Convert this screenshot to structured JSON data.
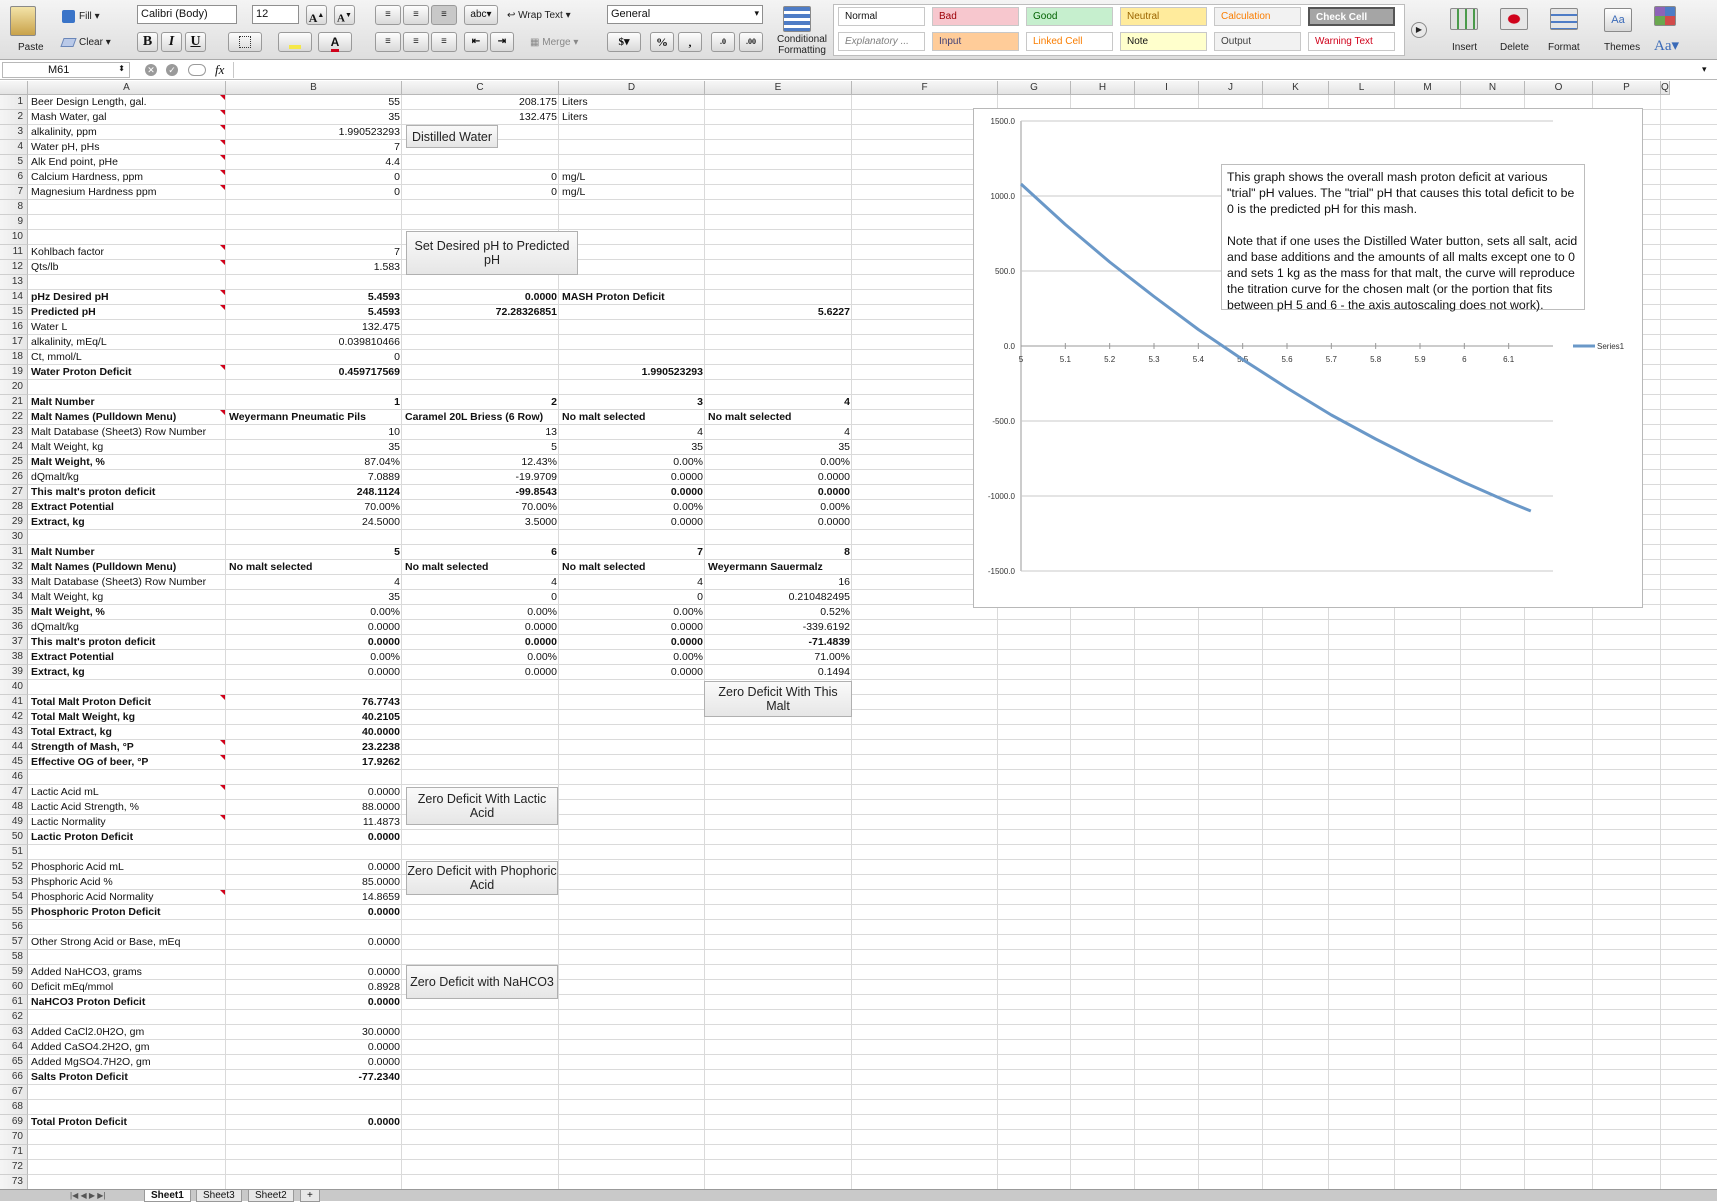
{
  "ribbon": {
    "paste": "Paste",
    "fill": "Fill",
    "clear": "Clear",
    "font_name": "Calibri (Body)",
    "font_size": "12",
    "wrap_text": "Wrap Text",
    "merge": "Merge",
    "number_format": "General",
    "conditional_formatting": "Conditional Formatting",
    "styles": [
      {
        "label": "Normal",
        "bg": "#ffffff",
        "fg": "#111111"
      },
      {
        "label": "Bad",
        "bg": "#f7c7ce",
        "fg": "#9c0006"
      },
      {
        "label": "Good",
        "bg": "#c6efce",
        "fg": "#006100"
      },
      {
        "label": "Neutral",
        "bg": "#ffeb9c",
        "fg": "#9c6500"
      },
      {
        "label": "Calculation",
        "bg": "#f2f2f2",
        "fg": "#fa7d00"
      },
      {
        "label": "Check Cell",
        "bg": "#a5a5a5",
        "fg": "#ffffff"
      },
      {
        "label": "Explanatory ...",
        "bg": "#ffffff",
        "fg": "#7f7f7f"
      },
      {
        "label": "Input",
        "bg": "#ffcc99",
        "fg": "#3f3f76"
      },
      {
        "label": "Linked Cell",
        "bg": "#ffffff",
        "fg": "#fa7d00"
      },
      {
        "label": "Note",
        "bg": "#ffffcc",
        "fg": "#111111"
      },
      {
        "label": "Output",
        "bg": "#f2f2f2",
        "fg": "#3f3f3f"
      },
      {
        "label": "Warning Text",
        "bg": "#ffffff",
        "fg": "#d0021b"
      }
    ],
    "insert": "Insert",
    "delete": "Delete",
    "format": "Format",
    "themes": "Themes",
    "aa": "Aa"
  },
  "formula_bar": {
    "name_box": "M61",
    "fx": "fx",
    "value": ""
  },
  "columns": [
    "A",
    "B",
    "C",
    "D",
    "E",
    "F",
    "G",
    "H",
    "I",
    "J",
    "K",
    "L",
    "M",
    "N",
    "O",
    "P",
    "Q"
  ],
  "rows": [
    {
      "n": 1,
      "A": "Beer Design Length, gal.",
      "B": "55",
      "C": "208.175",
      "D": "Liters"
    },
    {
      "n": 2,
      "A": "Mash Water, gal",
      "B": "35",
      "C": "132.475",
      "D": "Liters"
    },
    {
      "n": 3,
      "A": "alkalinity, ppm",
      "B": "1.990523293"
    },
    {
      "n": 4,
      "A": "Water pH, pHs",
      "B": "7"
    },
    {
      "n": 5,
      "A": "Alk End point, pHe",
      "B": "4.4"
    },
    {
      "n": 6,
      "A": "Calcium Hardness, ppm",
      "B": "0",
      "C": "0",
      "D": "mg/L"
    },
    {
      "n": 7,
      "A": "Magnesium Hardness ppm",
      "B": "0",
      "C": "0",
      "D": "mg/L"
    },
    {
      "n": 8
    },
    {
      "n": 9
    },
    {
      "n": 10
    },
    {
      "n": 11,
      "A": "Kohlbach factor",
      "B": "7"
    },
    {
      "n": 12,
      "A": "Qts/lb",
      "B": "1.583"
    },
    {
      "n": 13
    },
    {
      "n": 14,
      "A": "pHz Desired pH",
      "B": "5.4593",
      "C": "0.0000",
      "D": "MASH Proton Deficit",
      "bold": true
    },
    {
      "n": 15,
      "A": "Predicted pH",
      "B": "5.4593",
      "C": "72.28326851",
      "E": "5.6227",
      "bold": true
    },
    {
      "n": 16,
      "A": "Water L",
      "B": "132.475"
    },
    {
      "n": 17,
      "A": "alkalinity,  mEq/L",
      "B": "0.039810466"
    },
    {
      "n": 18,
      "A": "Ct, mmol/L",
      "B": "0"
    },
    {
      "n": 19,
      "A": "Water Proton Deficit",
      "B": "0.459717569",
      "D": "1.990523293",
      "bold": true
    },
    {
      "n": 20
    },
    {
      "n": 21,
      "A": "Malt Number",
      "B": "1",
      "C": "2",
      "D": "3",
      "E": "4",
      "bold": true
    },
    {
      "n": 22,
      "A": "Malt Names (Pulldown Menu)",
      "B": "Weyermann Pneumatic Pils",
      "C": "Caramel 20L Briess (6 Row)",
      "D": "No malt selected",
      "E": "No malt selected",
      "bold": true,
      "leftText": true
    },
    {
      "n": 23,
      "A": "Malt Database (Sheet3) Row Number",
      "B": "10",
      "C": "13",
      "D": "4",
      "E": "4"
    },
    {
      "n": 24,
      "A": "Malt  Weight, kg",
      "B": "35",
      "C": "5",
      "D": "35",
      "E": "35"
    },
    {
      "n": 25,
      "A": "Malt Weight, %",
      "B": "87.04%",
      "C": "12.43%",
      "D": "0.00%",
      "E": "0.00%",
      "boldA": true
    },
    {
      "n": 26,
      "A": "dQmalt/kg",
      "B": "7.0889",
      "C": "-19.9709",
      "D": "0.0000",
      "E": "0.0000"
    },
    {
      "n": 27,
      "A": "This malt's proton deficit",
      "B": "248.1124",
      "C": "-99.8543",
      "D": "0.0000",
      "E": "0.0000",
      "bold": true
    },
    {
      "n": 28,
      "A": "Extract Potential",
      "B": "70.00%",
      "C": "70.00%",
      "D": "0.00%",
      "E": "0.00%",
      "boldA": true
    },
    {
      "n": 29,
      "A": "Extract, kg",
      "B": "24.5000",
      "C": "3.5000",
      "D": "0.0000",
      "E": "0.0000",
      "boldA": true
    },
    {
      "n": 30
    },
    {
      "n": 31,
      "A": "Malt Number",
      "B": "5",
      "C": "6",
      "D": "7",
      "E": "8",
      "bold": true
    },
    {
      "n": 32,
      "A": "Malt Names (Pulldown Menu)",
      "B": "No malt selected",
      "C": "No malt selected",
      "D": "No malt selected",
      "E": "Weyermann Sauermalz",
      "bold": true,
      "leftText": true
    },
    {
      "n": 33,
      "A": "Malt Database (Sheet3) Row Number",
      "B": "4",
      "C": "4",
      "D": "4",
      "E": "16"
    },
    {
      "n": 34,
      "A": "Malt  Weight, kg",
      "B": "35",
      "C": "0",
      "D": "0",
      "E": "0.210482495"
    },
    {
      "n": 35,
      "A": "Malt Weight, %",
      "B": "0.00%",
      "C": "0.00%",
      "D": "0.00%",
      "E": "0.52%",
      "boldA": true
    },
    {
      "n": 36,
      "A": "dQmalt/kg",
      "B": "0.0000",
      "C": "0.0000",
      "D": "0.0000",
      "E": "-339.6192"
    },
    {
      "n": 37,
      "A": "This malt's proton deficit",
      "B": "0.0000",
      "C": "0.0000",
      "D": "0.0000",
      "E": "-71.4839",
      "bold": true
    },
    {
      "n": 38,
      "A": "Extract Potential",
      "B": "0.00%",
      "C": "0.00%",
      "D": "0.00%",
      "E": "71.00%",
      "boldA": true
    },
    {
      "n": 39,
      "A": "Extract, kg",
      "B": "0.0000",
      "C": "0.0000",
      "D": "0.0000",
      "E": "0.1494",
      "boldA": true
    },
    {
      "n": 40
    },
    {
      "n": 41,
      "A": "Total Malt Proton Deficit",
      "B": "76.7743",
      "bold": true
    },
    {
      "n": 42,
      "A": "Total Malt Weight, kg",
      "B": "40.2105",
      "bold": true
    },
    {
      "n": 43,
      "A": "Total Extract, kg",
      "B": "40.0000",
      "bold": true
    },
    {
      "n": 44,
      "A": "Strength of Mash, °P",
      "B": "23.2238",
      "bold": true
    },
    {
      "n": 45,
      "A": "Effective OG of beer, °P",
      "B": "17.9262",
      "bold": true
    },
    {
      "n": 46
    },
    {
      "n": 47,
      "A": "Lactic Acid mL",
      "B": "0.0000"
    },
    {
      "n": 48,
      "A": "Lactic Acid Strength, %",
      "B": "88.0000"
    },
    {
      "n": 49,
      "A": "Lactic Normality",
      "B": "11.4873"
    },
    {
      "n": 50,
      "A": "Lactic Proton Deficit",
      "B": "0.0000",
      "bold": true
    },
    {
      "n": 51
    },
    {
      "n": 52,
      "A": "Phosphoric Acid mL",
      "B": "0.0000"
    },
    {
      "n": 53,
      "A": "Phsphoric Acid %",
      "B": "85.0000"
    },
    {
      "n": 54,
      "A": "Phosphoric Acid Normality",
      "B": "14.8659"
    },
    {
      "n": 55,
      "A": "Phosphoric Proton Deficit",
      "B": "0.0000",
      "bold": true
    },
    {
      "n": 56
    },
    {
      "n": 57,
      "A": "Other Strong Acid or Base, mEq",
      "B": "0.0000"
    },
    {
      "n": 58
    },
    {
      "n": 59,
      "A": "Added NaHCO3, grams",
      "B": "0.0000"
    },
    {
      "n": 60,
      "A": "Deficit mEq/mmol",
      "B": "0.8928"
    },
    {
      "n": 61,
      "A": "NaHCO3 Proton Deficit",
      "B": "0.0000",
      "bold": true
    },
    {
      "n": 62
    },
    {
      "n": 63,
      "A": "Added CaCl2.0H2O, gm",
      "B": "30.0000"
    },
    {
      "n": 64,
      "A": "Added CaSO4.2H2O, gm",
      "B": "0.0000"
    },
    {
      "n": 65,
      "A": "Added MgSO4.7H2O, gm",
      "B": "0.0000"
    },
    {
      "n": 66,
      "A": "Salts Proton Deficit",
      "B": "-77.2340",
      "bold": true
    },
    {
      "n": 67
    },
    {
      "n": 68
    },
    {
      "n": 69,
      "A": "Total Proton Deficit",
      "B": "0.0000",
      "bold": true
    },
    {
      "n": 70
    },
    {
      "n": 71
    },
    {
      "n": 72
    },
    {
      "n": 73
    }
  ],
  "comment_rows": [
    1,
    2,
    3,
    4,
    5,
    6,
    7,
    11,
    12,
    14,
    15,
    19,
    22,
    41,
    44,
    45,
    47,
    49,
    54
  ],
  "buttons": {
    "distilled_water": "Distilled Water",
    "set_desired_ph": "Set Desired pH to Predicted pH",
    "zero_malt": "Zero Deficit With This Malt",
    "zero_lactic": "Zero Deficit With Lactic Acid",
    "zero_phosphoric": "Zero Deficit with Phophoric Acid",
    "zero_nahco3": "Zero Deficit with NaHCO3"
  },
  "chart_note": "This graph shows the overall mash proton deficit at various \"trial\" pH values. The \"trial\" pH that causes this total deficit to be 0 is the predicted pH for this mash.\n\nNote that if one uses the Distilled Water button, sets all salt, acid and base additions and the amounts of all malts except one to 0 and sets 1 kg as the mass for that malt, the curve will reproduce the titration curve for the chosen malt (or the portion that fits between pH 5 and 6 - the axis autoscaling does not work).",
  "chart_data": {
    "type": "line",
    "x": [
      5.0,
      5.1,
      5.2,
      5.3,
      5.4,
      5.5,
      5.6,
      5.7,
      5.8,
      5.9,
      6.0,
      6.1,
      6.15
    ],
    "series": [
      {
        "name": "Series1",
        "color": "#6a98c8",
        "values": [
          1080,
          810,
          560,
          330,
          110,
          -90,
          -280,
          -460,
          -620,
          -770,
          -910,
          -1040,
          -1100
        ]
      }
    ],
    "xticks": [
      "5",
      "5.1",
      "5.2",
      "5.3",
      "5.4",
      "5.5",
      "5.6",
      "5.7",
      "5.8",
      "5.9",
      "6",
      "6.1"
    ],
    "yticks": [
      "1500.0",
      "1000.0",
      "500.0",
      "0.0",
      "-500.0",
      "-1000.0",
      "-1500.0"
    ],
    "ylim": [
      -1500,
      1500
    ],
    "xlim": [
      5,
      6.2
    ],
    "legend_position": "right",
    "grid": true
  },
  "sheet_tabs": [
    "Sheet1",
    "Sheet3",
    "Sheet2",
    "+"
  ]
}
